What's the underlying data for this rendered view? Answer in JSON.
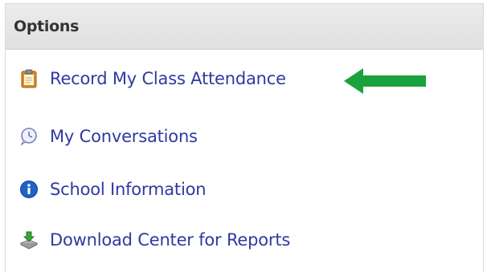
{
  "panel": {
    "title": "Options"
  },
  "items": [
    {
      "label": "Record My Class Attendance",
      "icon": "clipboard-icon"
    },
    {
      "label": "My Conversations",
      "icon": "conversation-clock-icon"
    },
    {
      "label": "School Information",
      "icon": "info-icon"
    },
    {
      "label": "Download Center for Reports",
      "icon": "download-icon"
    }
  ],
  "annotation": {
    "arrow_color": "#1aa33c"
  },
  "colors": {
    "link": "#2e3aa0",
    "header_bg": "#e6e6e6"
  }
}
